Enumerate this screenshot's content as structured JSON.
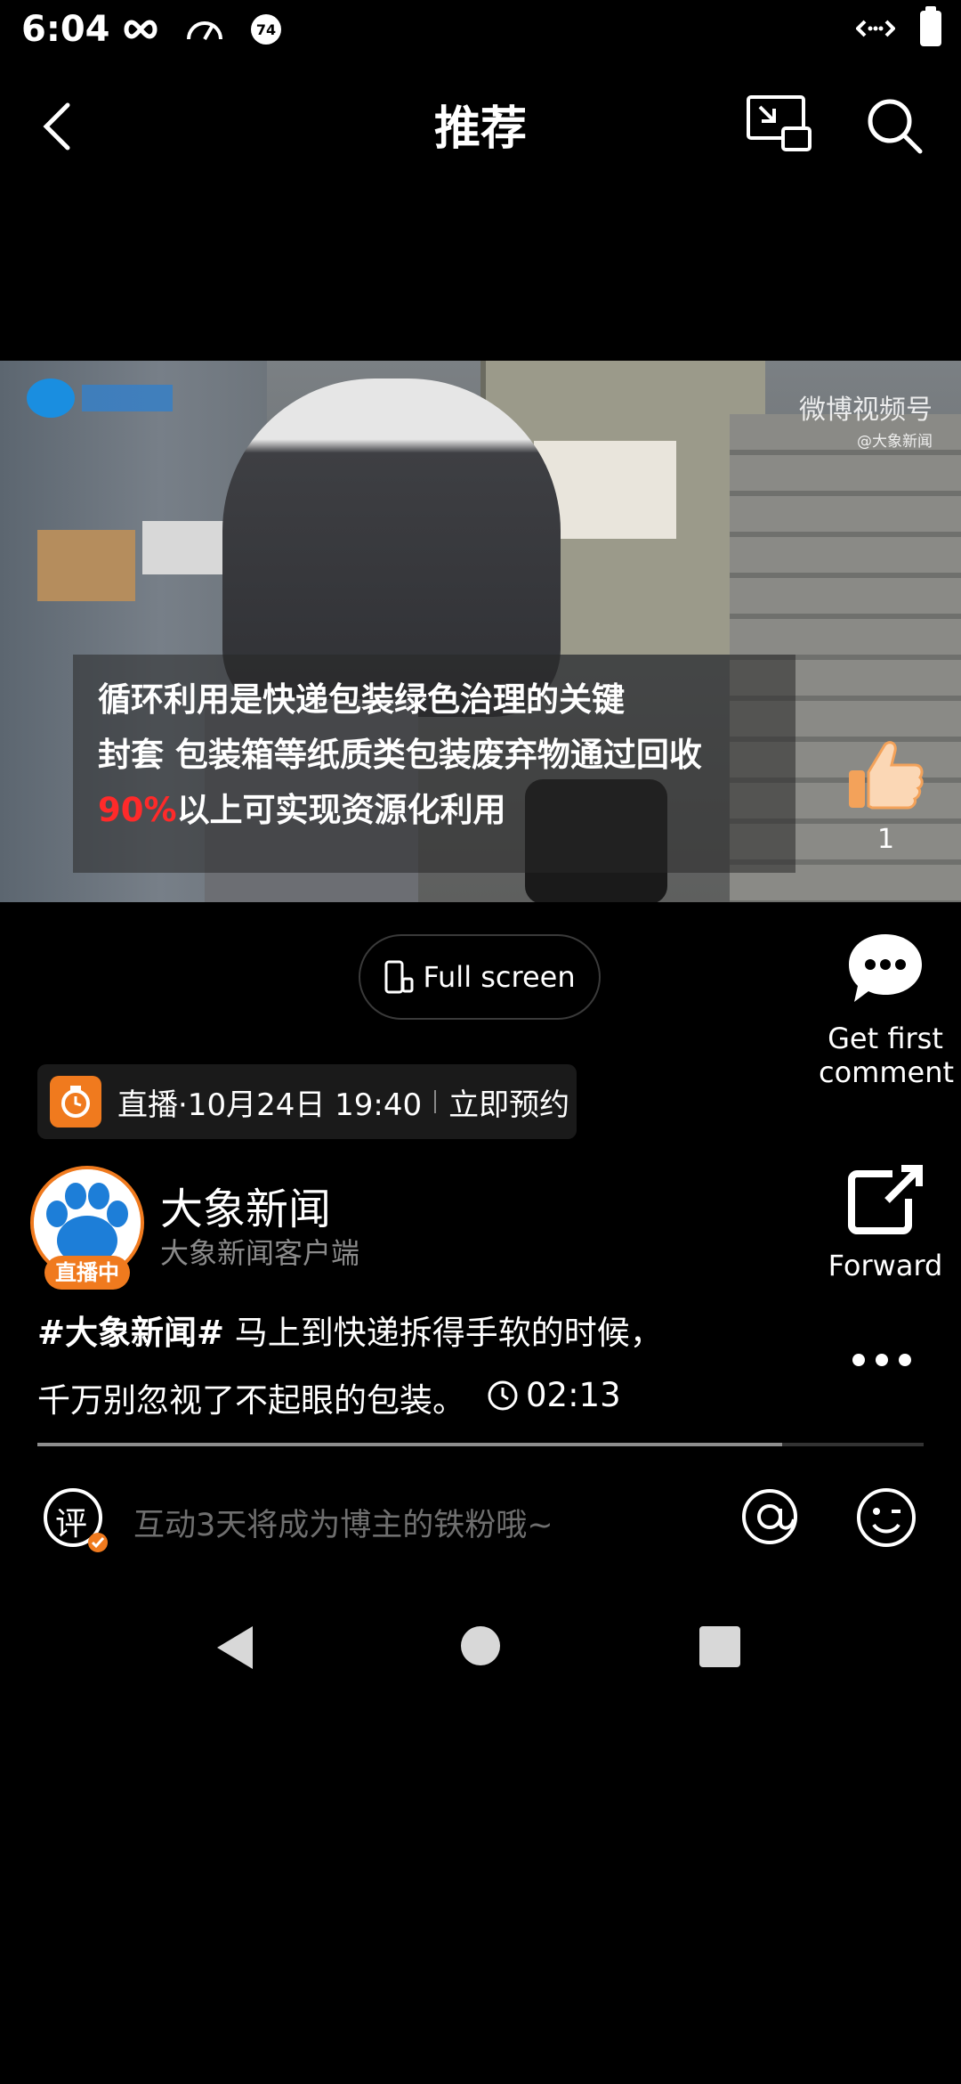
{
  "status_bar": {
    "time": "6:04",
    "badge": "74"
  },
  "header": {
    "title": "推荐"
  },
  "video": {
    "watermark": "微博视频号",
    "watermark_sub": "@大象新闻",
    "subtitle_line1": "循环利用是快递包装绿色治理的关键",
    "subtitle_line2": "封套 包装箱等纸质类包装废弃物通过回收",
    "subtitle_line3_highlight": "90%",
    "subtitle_line3_rest": "以上可实现资源化利用",
    "like_count": "1"
  },
  "fullscreen_label": "Full screen",
  "actions": {
    "comment_label": "Get first\ncomment",
    "forward_label": "Forward"
  },
  "live": {
    "label": "直播·10月24日 19:40",
    "reserve": "立即预约"
  },
  "author": {
    "name": "大象新闻",
    "subtitle": "大象新闻客户端",
    "live_badge": "直播中"
  },
  "post": {
    "hashtag": "#大象新闻#",
    "text_line1": " 马上到快递拆得手软的时候，",
    "text_line2": "千万别忽视了不起眼的包装。",
    "duration": "02:13"
  },
  "progress": {
    "fraction": 0.84
  },
  "comment_bar": {
    "placeholder": "互动3天将成为博主的铁粉哦~",
    "comment_icon_char": "评"
  },
  "colors": {
    "accent": "#f07a1e",
    "highlight_red": "#ff2a2a"
  }
}
